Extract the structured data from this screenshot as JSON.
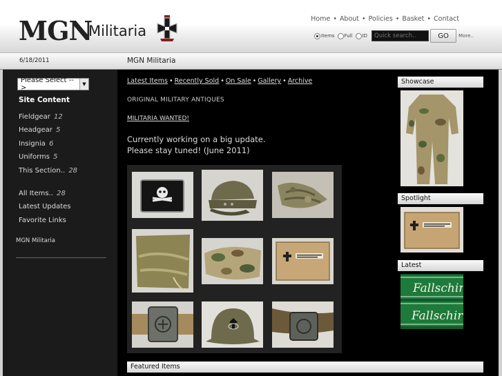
{
  "header": {
    "logo_mgn": "MGN",
    "logo_militaria": "Militaria",
    "nav": [
      "Home",
      "About",
      "Policies",
      "Basket",
      "Contact"
    ],
    "search": {
      "options": [
        "Items",
        "Full",
        "ID"
      ],
      "selected": "Items",
      "placeholder": "Quick search..",
      "go_label": "GO",
      "more_label": "More.."
    }
  },
  "datebar": {
    "date": "6/18/2011",
    "title": "MGN Militaria"
  },
  "sidebar": {
    "select_label": "Please Select -->",
    "heading": "Site Content",
    "items": [
      {
        "label": "Fieldgear",
        "count": "12"
      },
      {
        "label": "Headgear",
        "count": "5"
      },
      {
        "label": "Insignia",
        "count": "6"
      },
      {
        "label": "Uniforms",
        "count": "5"
      },
      {
        "label": "This Section..",
        "count": "28"
      }
    ],
    "links": [
      {
        "label": "All Items..",
        "count": "28"
      },
      {
        "label": "Latest Updates",
        "count": ""
      },
      {
        "label": "Favorite Links",
        "count": ""
      }
    ],
    "footer_label": "MGN Militaria"
  },
  "content": {
    "catnav": [
      "Latest Items",
      "Recently Sold",
      "On Sale",
      "Gallery",
      "Archive"
    ],
    "tagline": "ORIGINAL MILITARY ANTIQUES",
    "wanted": "MILITARIA WANTED!",
    "notice_line1": "Currently working on a big update.",
    "notice_line2": "Please stay tuned! (June 2011)"
  },
  "gallery": [
    "collar-tab-skull",
    "field-cap",
    "camo-gloves",
    "canvas-strap",
    "camo-smock",
    "boxed-medal",
    "belt-buckle",
    "steel-helmet",
    "buckle-on-belt"
  ],
  "right": {
    "showcase": "Showcase",
    "spotlight": "Spotlight",
    "latest": "Latest",
    "latest_text": "Fallschir"
  },
  "featured": "Featured Items",
  "colors": {
    "background": "#000000",
    "panel": "#222222",
    "cuff_green": "#1e7a3a"
  }
}
